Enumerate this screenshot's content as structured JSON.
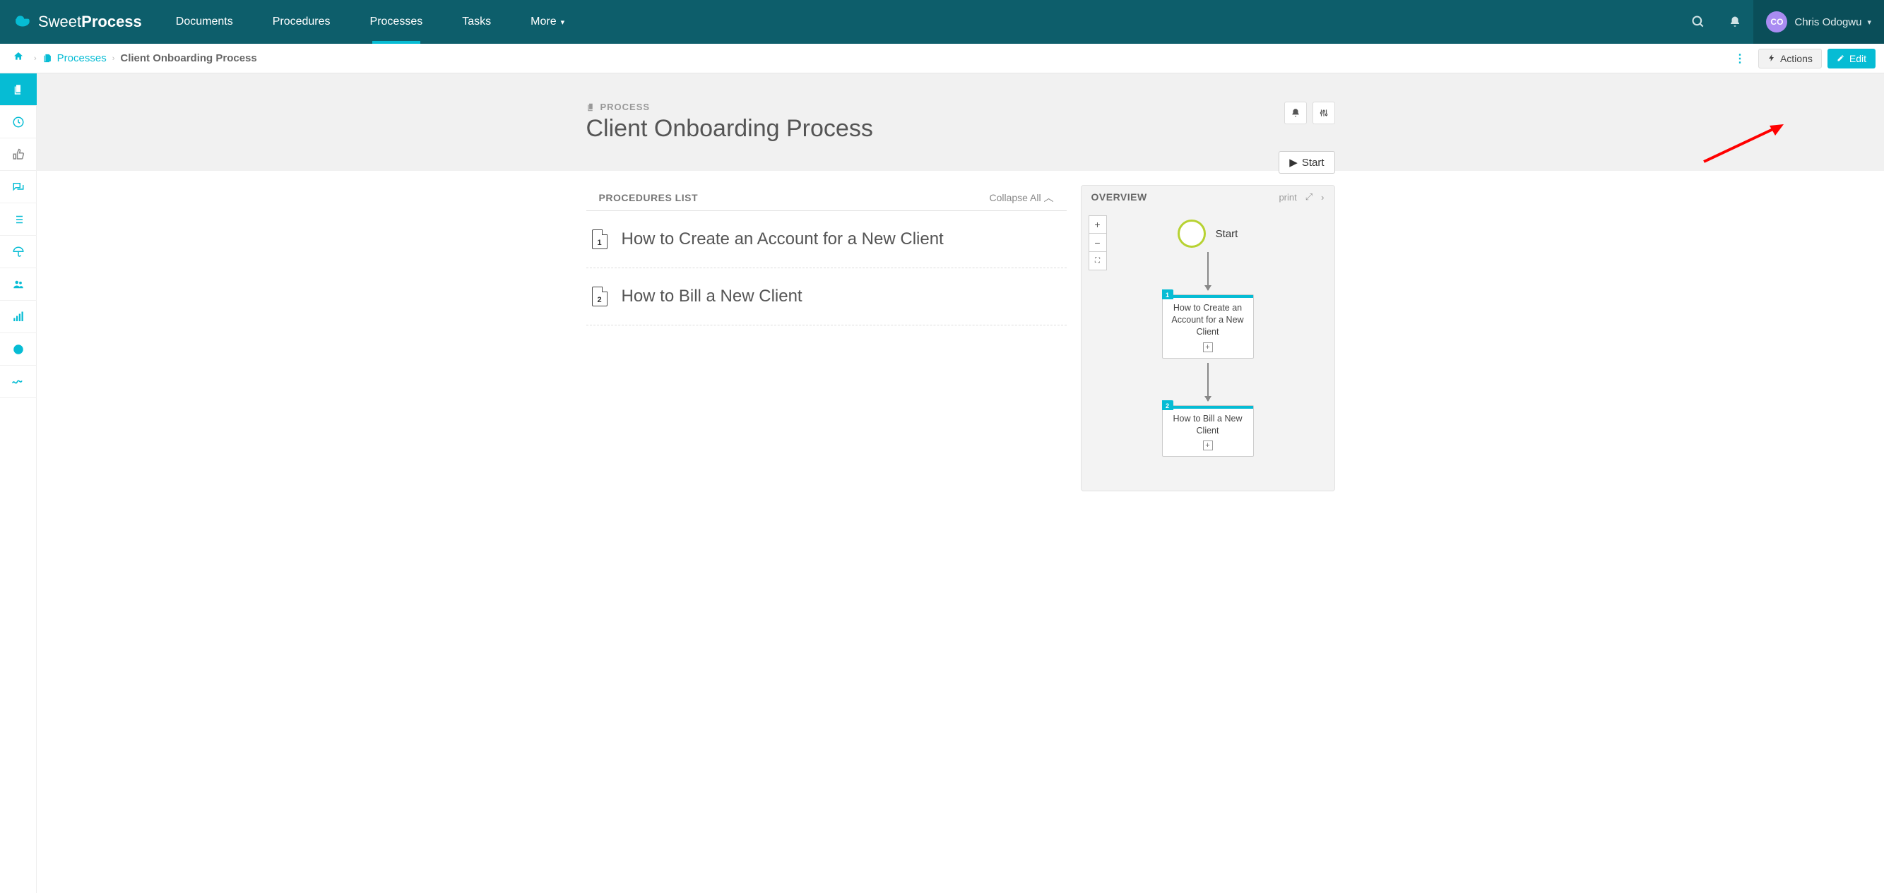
{
  "brand": {
    "light": "Sweet",
    "bold": "Process"
  },
  "nav": {
    "items": [
      "Documents",
      "Procedures",
      "Processes",
      "Tasks",
      "More"
    ],
    "active_index": 2
  },
  "user": {
    "initials": "CO",
    "name": "Chris Odogwu"
  },
  "breadcrumb": {
    "link_label": "Processes",
    "current": "Client Onboarding Process"
  },
  "topbar_buttons": {
    "actions": "Actions",
    "edit": "Edit"
  },
  "page": {
    "type_label": "PROCESS",
    "title": "Client Onboarding Process",
    "start_label": "Start"
  },
  "procedures": {
    "header": "PROCEDURES LIST",
    "collapse_label": "Collapse All",
    "items": [
      {
        "num": "1",
        "title": "How to Create an Account for a New Client"
      },
      {
        "num": "2",
        "title": "How to Bill a New Client"
      }
    ]
  },
  "overview": {
    "title": "OVERVIEW",
    "print": "print",
    "start_label": "Start",
    "nodes": [
      {
        "num": "1",
        "text": "How to Create an Account for a New Client"
      },
      {
        "num": "2",
        "text": "How to Bill a New Client"
      }
    ]
  }
}
